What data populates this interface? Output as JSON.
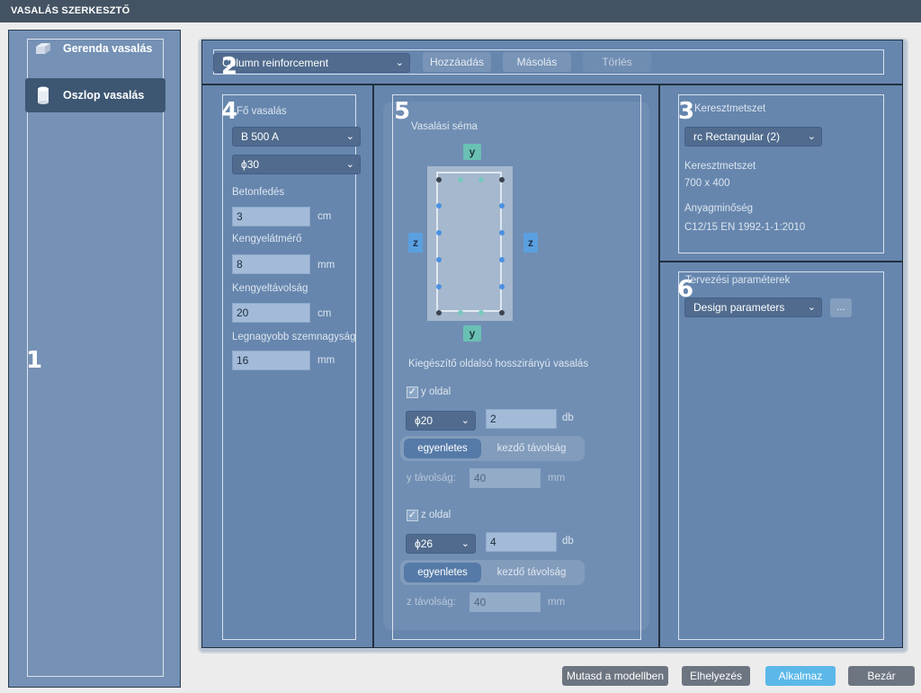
{
  "window": {
    "title": "VASALÁS SZERKESZTŐ"
  },
  "sidebar": {
    "items": [
      {
        "label": "Gerenda vasalás",
        "icon": "beam-icon",
        "active": false
      },
      {
        "label": "Oszlop vasalás",
        "icon": "column-icon",
        "active": true
      }
    ]
  },
  "region_numbers": [
    "1",
    "2",
    "3",
    "4",
    "5",
    "6"
  ],
  "toolbar": {
    "selected": "Column reinforcement",
    "add_label": "Hozzáadás",
    "copy_label": "Másolás",
    "delete_label": "Törlés"
  },
  "main_rebar": {
    "title": "Fő vasalás",
    "material": "B 500 A",
    "diameter": "ϕ30",
    "cover_label": "Betonfedés",
    "cover_value": "3",
    "cover_unit": "cm",
    "stirrup_diam_label": "Kengyelátmérő",
    "stirrup_diam_value": "8",
    "stirrup_diam_unit": "mm",
    "stirrup_spacing_label": "Kengyeltávolság",
    "stirrup_spacing_value": "20",
    "stirrup_spacing_unit": "cm",
    "max_aggregate_label": "Legnagyobb szemnagyság",
    "max_aggregate_value": "16",
    "max_aggregate_unit": "mm"
  },
  "scheme": {
    "title": "Vasalási séma",
    "y_label": "y",
    "z_label": "z",
    "extra_title": "Kiegészítő oldalsó hosszirányú vasalás",
    "y_side": {
      "label": "y oldal",
      "checked": true,
      "diameter": "ϕ20",
      "count": "2",
      "count_unit": "db",
      "seg_on": "egyenletes",
      "seg_off": "kezdő távolság",
      "distance_label": "y távolság:",
      "distance_value": "40",
      "distance_unit": "mm"
    },
    "z_side": {
      "label": "z oldal",
      "checked": true,
      "diameter": "ϕ26",
      "count": "4",
      "count_unit": "db",
      "seg_on": "egyenletes",
      "seg_off": "kezdő távolság",
      "distance_label": "z távolság:",
      "distance_value": "40",
      "distance_unit": "mm"
    }
  },
  "cross_section": {
    "title": "Keresztmetszet",
    "selected": "rc Rectangular (2)",
    "dim_label": "Keresztmetszet",
    "dim_value": "700 x 400",
    "material_label": "Anyagminőség",
    "material_value": "C12/15 EN 1992-1-1:2010"
  },
  "design": {
    "title": "Tervezési paraméterek",
    "selected": "Design parameters",
    "more_label": "..."
  },
  "footer": {
    "show_in_model": "Mutasd a modellben",
    "placement": "Elhelyezés",
    "apply": "Alkalmaz",
    "close": "Bezár"
  },
  "colors": {
    "titlebar": "#435363",
    "overlay": "#466ea0",
    "apply_button": "#5bb8e8",
    "button_gray": "#6d7580"
  }
}
